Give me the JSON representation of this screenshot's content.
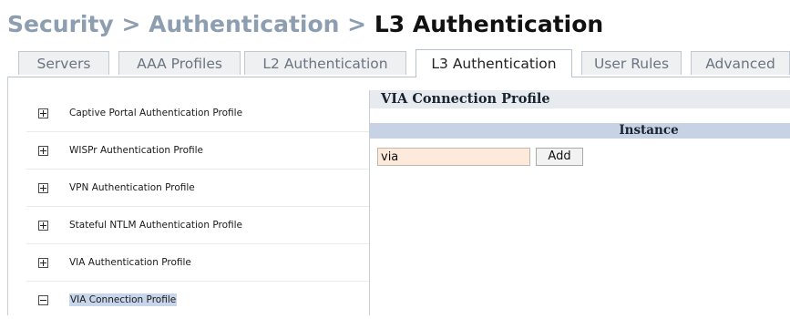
{
  "breadcrumb": {
    "part1": "Security",
    "sep1": " > ",
    "part2": "Authentication",
    "sep2": " > ",
    "current": "L3 Authentication"
  },
  "tabs": [
    {
      "label": "Servers",
      "active": false
    },
    {
      "label": "AAA Profiles",
      "active": false
    },
    {
      "label": "L2 Authentication",
      "active": false
    },
    {
      "label": "L3 Authentication",
      "active": true
    },
    {
      "label": "User Rules",
      "active": false
    },
    {
      "label": "Advanced",
      "active": false
    }
  ],
  "tree": {
    "items": [
      {
        "label": "Captive Portal Authentication Profile",
        "expanded": false
      },
      {
        "label": "WISPr Authentication Profile",
        "expanded": false
      },
      {
        "label": "VPN Authentication Profile",
        "expanded": false
      },
      {
        "label": "Stateful NTLM Authentication Profile",
        "expanded": false
      },
      {
        "label": "VIA Authentication Profile",
        "expanded": false
      },
      {
        "label": "VIA Connection Profile",
        "expanded": true,
        "selected": true
      }
    ]
  },
  "panel": {
    "title": "VIA Connection Profile",
    "column_header": "Instance",
    "input_value": "via",
    "add_label": "Add"
  },
  "colors": {
    "breadcrumb_muted": "#8d9eb0",
    "panel_title_bg": "#e7ebf0",
    "column_header_bg": "#c7d3e4",
    "input_bg": "#fdeadb",
    "selection_bg": "#c8d6ec"
  }
}
